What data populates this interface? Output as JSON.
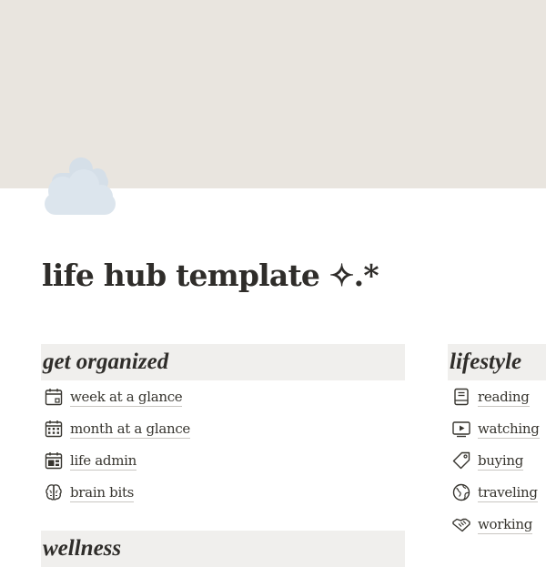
{
  "page": {
    "title": "life hub template ✧.*",
    "icon": "cloud-icon",
    "colors": {
      "cover": "#e9e5df",
      "section_header_bg": "#f0efed",
      "cloud": "#d5dfe8",
      "text": "#2f2d2a"
    }
  },
  "sections": {
    "organized": {
      "title": "get organized",
      "items": [
        {
          "label": "week at a glance",
          "icon": "calendar-week-icon"
        },
        {
          "label": "month at a glance",
          "icon": "calendar-month-icon"
        },
        {
          "label": "life admin",
          "icon": "calendar-admin-icon"
        },
        {
          "label": "brain bits",
          "icon": "brain-icon"
        }
      ]
    },
    "lifestyle": {
      "title": "lifestyle",
      "items": [
        {
          "label": "reading",
          "icon": "book-icon"
        },
        {
          "label": "watching",
          "icon": "tv-play-icon"
        },
        {
          "label": "buying",
          "icon": "price-tag-icon"
        },
        {
          "label": "traveling",
          "icon": "globe-icon"
        },
        {
          "label": "working",
          "icon": "handshake-icon"
        }
      ]
    },
    "wellness": {
      "title": "wellness"
    }
  }
}
